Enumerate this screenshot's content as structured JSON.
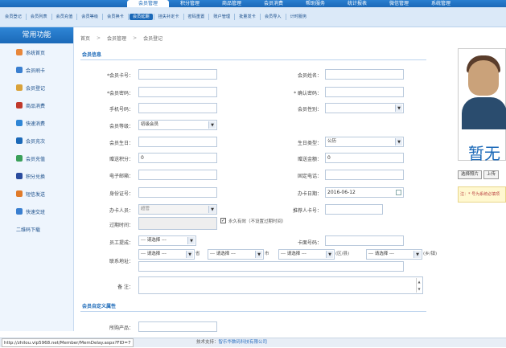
{
  "top_nav": [
    "会员管理",
    "积分管理",
    "商品管理",
    "会员消费",
    "帮助服务",
    "统计报表",
    "微信管理",
    "系统管理"
  ],
  "sub_nav": [
    "会员登记",
    "会员列表",
    "会员充值",
    "会员等级",
    "会员换卡",
    "会员延期",
    "挂失补定卡",
    "密码重置",
    "账户管理",
    "批量发卡",
    "会员导入",
    "计时服务"
  ],
  "sidebar": {
    "title": "常用功能",
    "items": [
      "系统首页",
      "会员刷卡",
      "会员登记",
      "商品消费",
      "快速消费",
      "会员充次",
      "会员充值",
      "积分兑换",
      "短信发送",
      "快速交班",
      "二维码下载"
    ]
  },
  "breadcrumb": [
    "首页",
    "会员管理",
    "会员登记"
  ],
  "section_info": "会员信息",
  "section_custom": "会员自定义属性",
  "form": {
    "card_no_label": "*会员卡号：",
    "name_label": "会员姓名：",
    "password_label": "*会员密码：",
    "confirm_password_label": "* 确认密码：",
    "phone_label": "手机号码：",
    "gender_label": "会员性别：",
    "level_label": "会员等级：",
    "level_value": "初级会员",
    "birthday_label": "会员生日：",
    "birthday_type_label": "生日类型：",
    "birthday_type_value": "公历",
    "gift_points_label": "赠送积分：",
    "gift_points_value": "0",
    "gift_amount_label": "赠送金额：",
    "gift_amount_value": "0",
    "email_label": "电子邮箱：",
    "landline_label": "固定电话：",
    "id_label": "身份证号：",
    "open_date_label": "办卡日期：",
    "open_date_value": "2016-06-12",
    "operator_label": "办卡人员：",
    "operator_value": "超管",
    "referrer_label": "推荐人卡号：",
    "expiry_label": "过期时间：",
    "permanent_label": "永久有效（不设置过期时间）",
    "staff_label": "员工提成：",
    "select_placeholder": "--- 请选择 ---",
    "card_face_label": "卡面号码：",
    "address_label": "联系地址：",
    "province_suffix": "省",
    "city_suffix": "市",
    "district_suffix": "(区/县)",
    "town_suffix": "(乡/镇)",
    "remark_label": "备  注：",
    "purchase_label": "所购产品："
  },
  "photo": {
    "caption": "暂无",
    "buttons": [
      "选择照片",
      "上传"
    ],
    "note": "注：* 号为系统必填项"
  },
  "statusbar": {
    "url": "http://zhilou.vip5968.net/Member/MemDelay.aspx?FID=7",
    "footer_prefix": "技术支持：",
    "footer_link": "智乐华数码科技有限公司"
  }
}
